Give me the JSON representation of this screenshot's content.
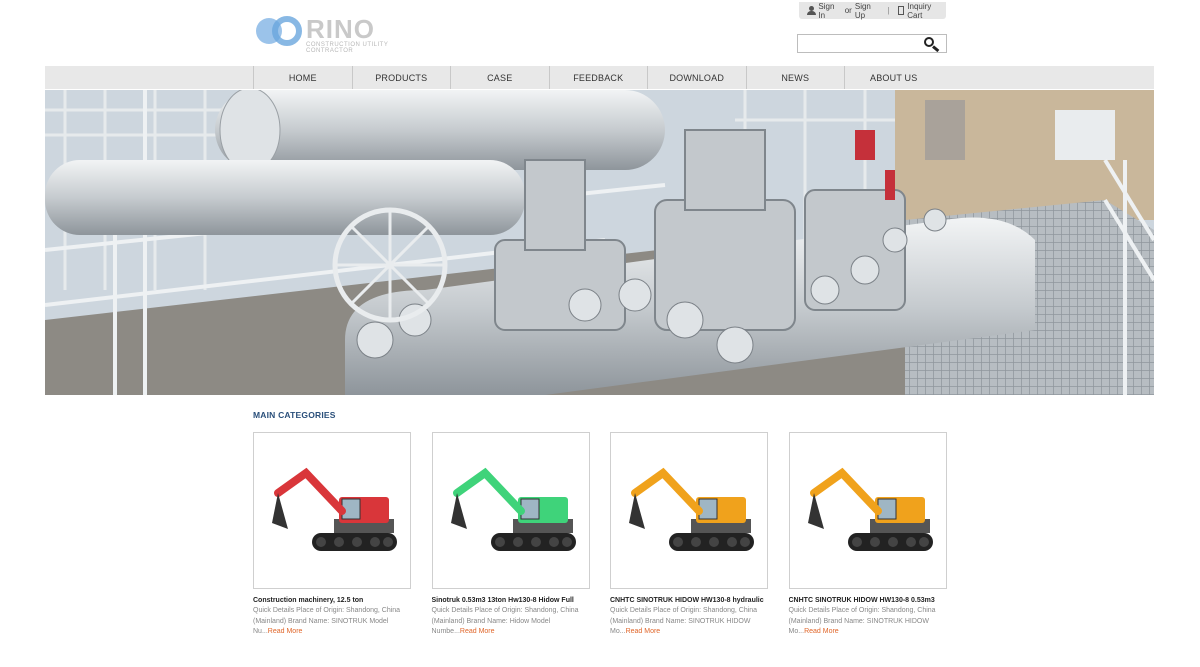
{
  "header": {
    "logo_text": "RINO",
    "logo_tagline": "CONSTRUCTION UTILITY CONTRACTOR",
    "signin_label": "Sign In",
    "or_label": "or",
    "signup_label": "Sign Up",
    "separator": "|",
    "inquiry_label": "Inquiry Cart",
    "search_value": "",
    "search_placeholder": ""
  },
  "nav": {
    "items": [
      "HOME",
      "PRODUCTS",
      "CASE",
      "FEEDBACK",
      "DOWNLOAD",
      "NEWS",
      "ABOUT US"
    ]
  },
  "main": {
    "section_title": "MAIN CATEGORIES",
    "products": [
      {
        "name": "Construction machinery, 12.5 ton",
        "desc": "Quick Details Place of Origin: Shandong, China (Mainland) Brand Name: SINOTRUK Model Nu...",
        "read_more": "Read More",
        "color": "#d9363a"
      },
      {
        "name": "Sinotruk 0.53m3 13ton Hw130-8 Hidow Full",
        "desc": "Quick Details Place of Origin: Shandong, China (Mainland) Brand Name: Hidow Model Numbe...",
        "read_more": "Read More",
        "color": "#3fd37a"
      },
      {
        "name": "CNHTC SINOTRUK HIDOW HW130-8 hydraulic",
        "desc": "Quick Details Place of Origin: Shandong, China (Mainland) Brand Name: SINOTRUK HIDOW Mo...",
        "read_more": "Read More",
        "color": "#f0a21c"
      },
      {
        "name": "CNHTC SINOTRUK HIDOW HW130-8 0.53m3",
        "desc": "Quick Details Place of Origin: Shandong, China (Mainland) Brand Name: SINOTRUK HIDOW Mo...",
        "read_more": "Read More",
        "color": "#f0a21c"
      }
    ]
  },
  "icons": {
    "user": "user-icon",
    "cart": "document-icon",
    "search": "search-icon"
  }
}
